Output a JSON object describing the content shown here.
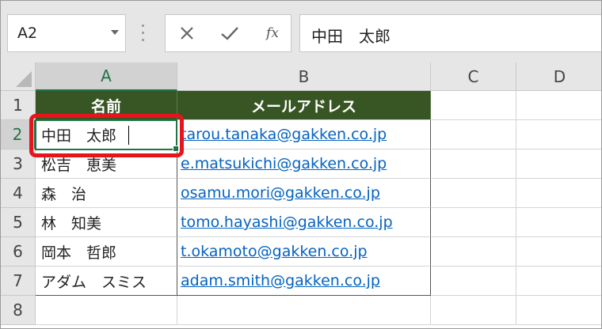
{
  "name_box": {
    "value": "A2"
  },
  "formula_bar": {
    "cancel_icon": "close-icon",
    "enter_icon": "check-icon",
    "function_label": "fx",
    "value": "中田　太郎"
  },
  "columns": [
    "A",
    "B",
    "C",
    "D"
  ],
  "rows": [
    "1",
    "2",
    "3",
    "4",
    "5",
    "6",
    "7",
    "8"
  ],
  "table": {
    "headers": [
      "名前",
      "メールアドレス"
    ],
    "records": [
      {
        "name": "中田　太郎",
        "email": "tarou.tanaka@gakken.co.jp"
      },
      {
        "name": "松吉　恵美",
        "email": "e.matsukichi@gakken.co.jp"
      },
      {
        "name": "森　治",
        "email": "osamu.mori@gakken.co.jp"
      },
      {
        "name": "林　知美",
        "email": "tomo.hayashi@gakken.co.jp"
      },
      {
        "name": "岡本　哲郎",
        "email": "t.okamoto@gakken.co.jp"
      },
      {
        "name": "アダム　スミス",
        "email": "adam.smith@gakken.co.jp"
      }
    ]
  },
  "colors": {
    "header_fill": "#375623",
    "link": "#0563c1",
    "selection": "#217346",
    "callout": "#e8141b"
  }
}
